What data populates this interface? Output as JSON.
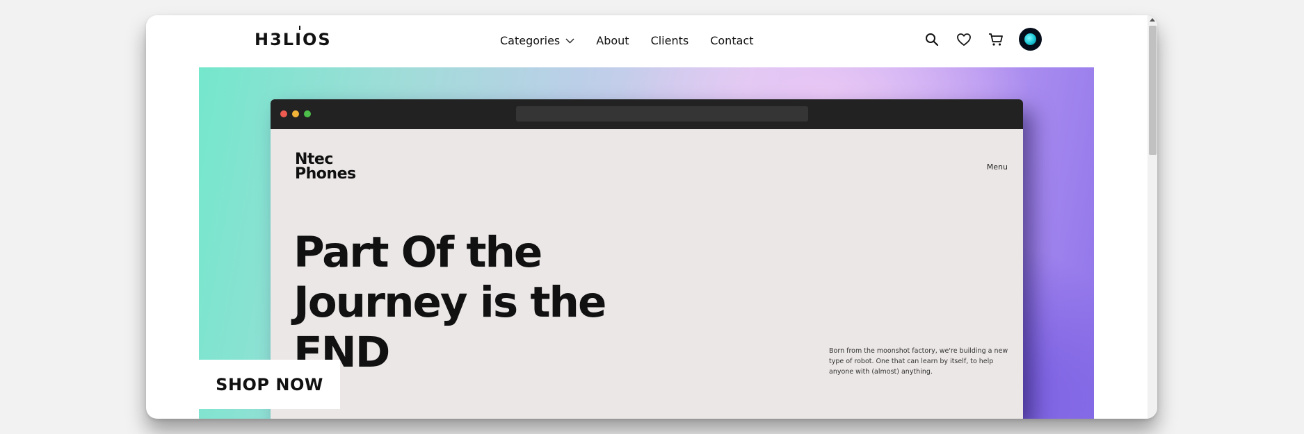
{
  "header": {
    "logo": "H3LIOS",
    "nav": [
      {
        "label": "Categories",
        "has_dropdown": true
      },
      {
        "label": "About"
      },
      {
        "label": "Clients"
      },
      {
        "label": "Contact"
      }
    ],
    "actions": [
      "search-icon",
      "heart-icon",
      "cart-icon",
      "avatar"
    ]
  },
  "hero": {
    "mockup": {
      "brand_line1": "Ntec",
      "brand_line2": "Phones",
      "menu_label": "Menu",
      "headline_line1": "Part Of the",
      "headline_line2": "Journey is the",
      "headline_line3": "END",
      "blurb": "Born from the moonshot factory, we're building a new type of robot. One that can learn by itself, to help anyone with (almost) anything."
    },
    "cta_label": "SHOP NOW"
  },
  "colors": {
    "accent_avatar": "#19c4d4",
    "gradient_start": "#74e7cc",
    "gradient_end": "#8f74ea",
    "mockup_bg": "#ebe7e6",
    "titlebar": "#222222"
  }
}
